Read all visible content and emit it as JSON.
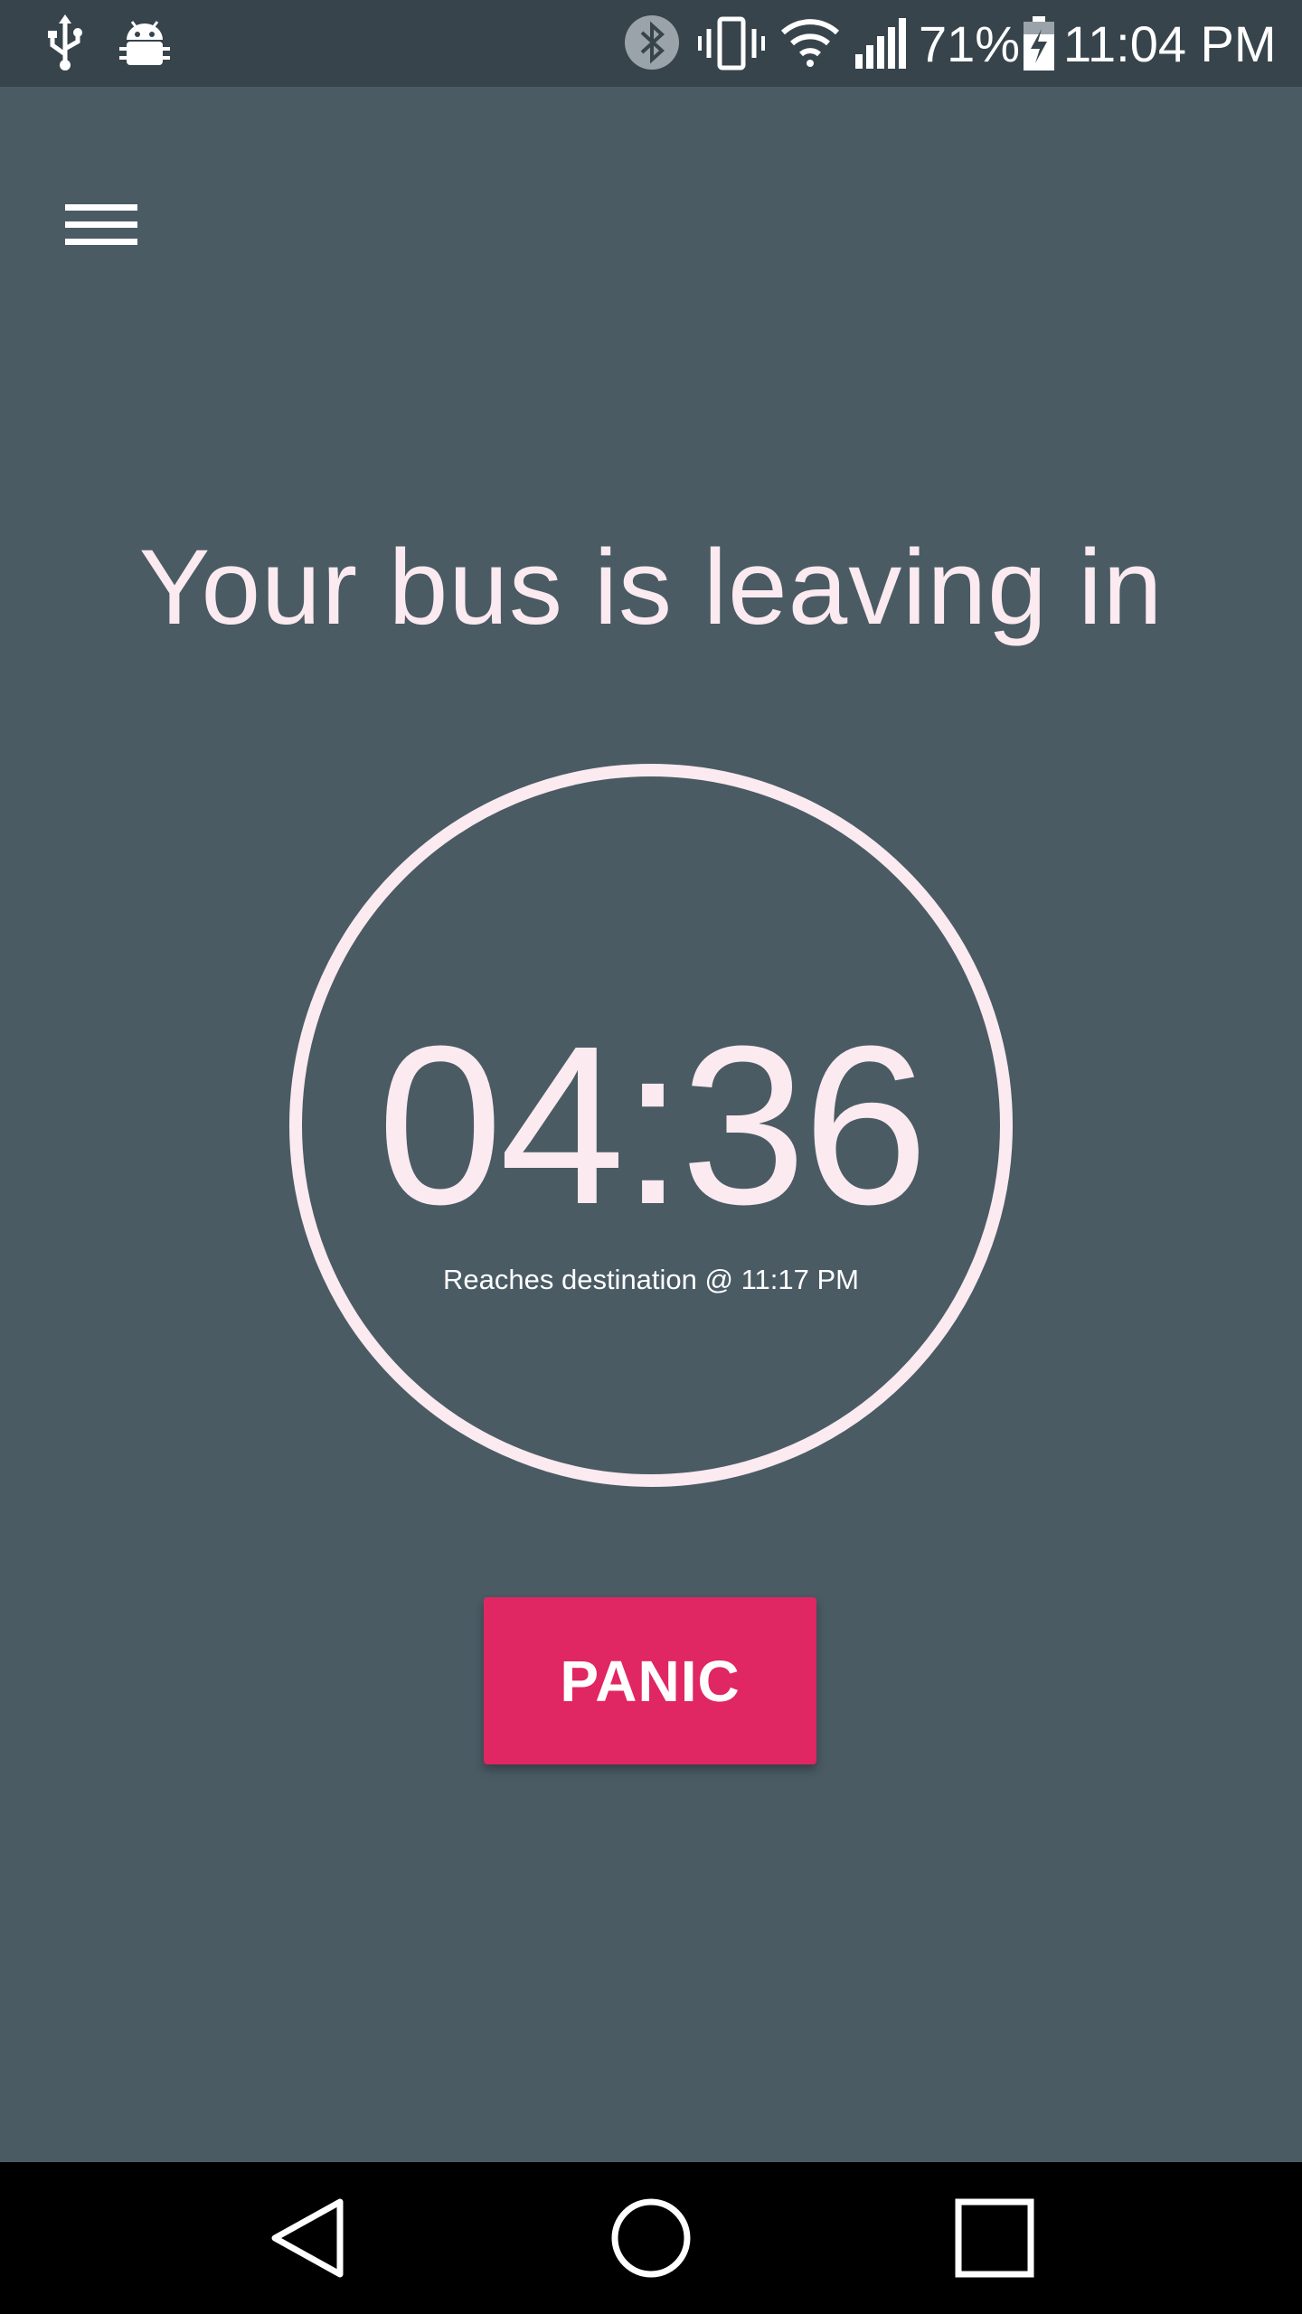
{
  "status_bar": {
    "battery_percent": "71%",
    "time": "11:04 PM",
    "icons": [
      "usb-icon",
      "android-debug-icon",
      "bluetooth-icon",
      "vibrate-icon",
      "wifi-icon",
      "signal-icon",
      "battery-charging-icon"
    ]
  },
  "header": {
    "menu_icon": "hamburger-menu-icon"
  },
  "main": {
    "headline": "Your bus is leaving in",
    "countdown": "04:36",
    "arrival": "Reaches destination @ 11:17 PM",
    "panic_label": "PANIC"
  },
  "nav_bar": {
    "icons": [
      "back-icon",
      "home-icon",
      "recents-icon"
    ]
  },
  "colors": {
    "background": "#4a5b64",
    "status_bar": "#37444c",
    "accent": "#e02663",
    "text": "#fbeaef"
  }
}
